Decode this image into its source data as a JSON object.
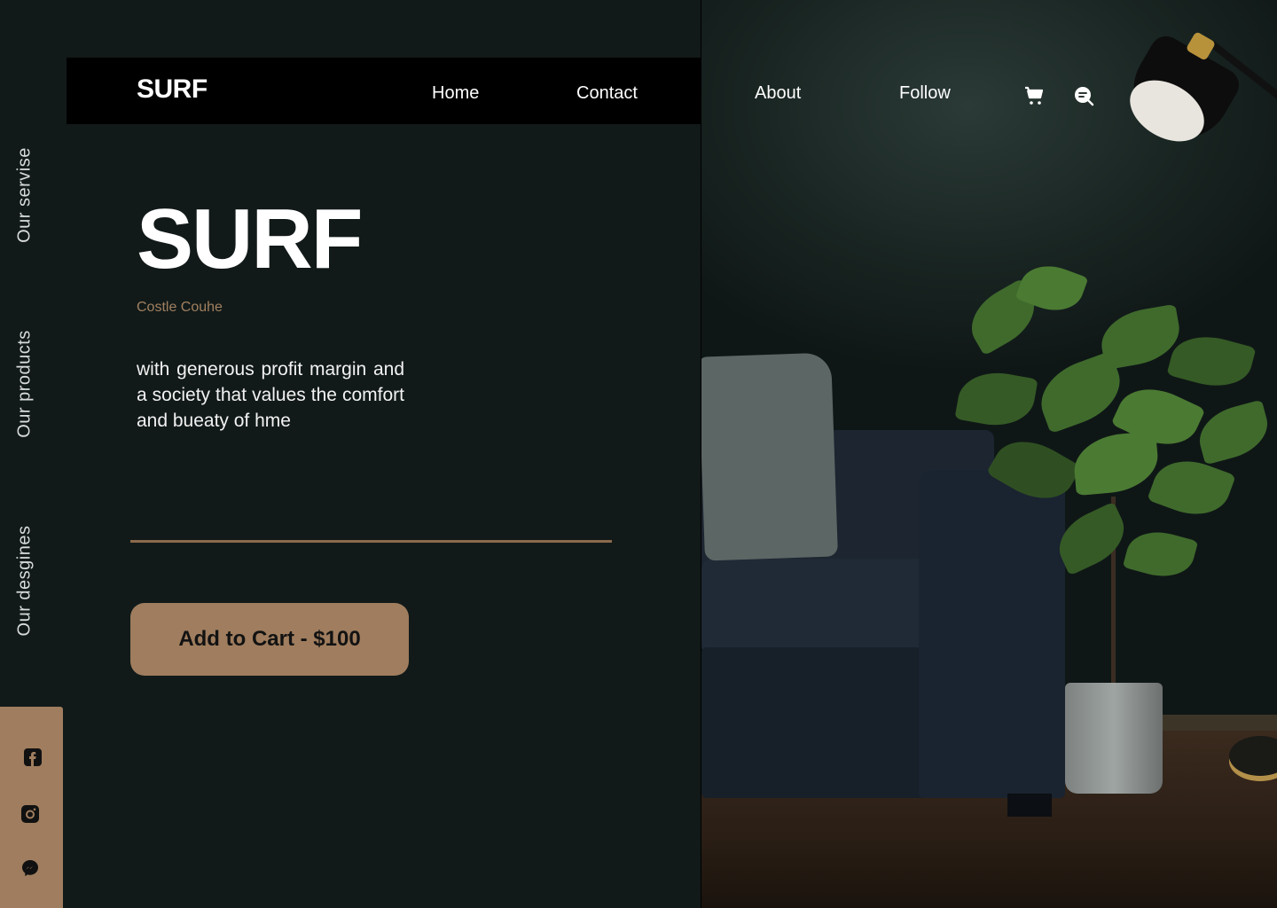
{
  "header": {
    "logo": "SURF",
    "nav": [
      "Home",
      "Contact",
      "About",
      "Follow"
    ],
    "icons": [
      "cart-icon",
      "search-icon"
    ]
  },
  "side_nav": [
    "Our servise",
    "Our products",
    "Our desgines"
  ],
  "social": [
    "facebook-icon",
    "instagram-icon",
    "messenger-icon"
  ],
  "hero": {
    "title": "SURF",
    "subtitle": "Costle Couhe",
    "description": "with  generous profit margin and  a  society  that  values the comfort and bueaty  of hme",
    "cta": "Add to Cart - $100"
  },
  "colors": {
    "background": "#121a19",
    "accent": "#9f7d5e",
    "header": "#000000"
  }
}
